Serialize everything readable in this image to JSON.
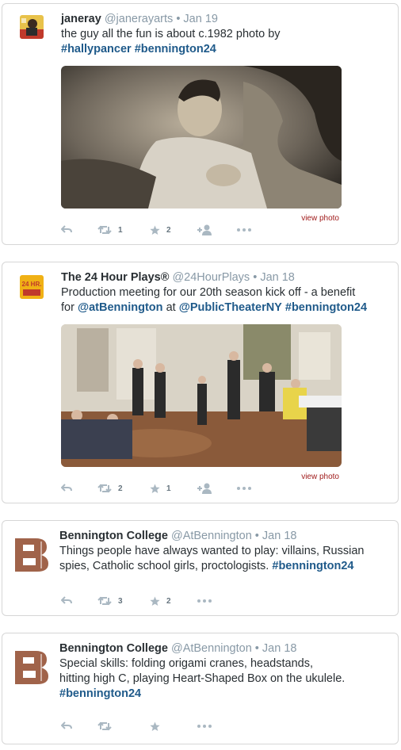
{
  "tweets": [
    {
      "name": "janeray",
      "handle": "@janerayarts",
      "dot": "•",
      "date": "Jan 19",
      "text_line1": "the guy all the fun is about c.1982 photo by",
      "hashtag1": "#hallypancer",
      "hashtag2": "#bennington24",
      "view_photo": "view photo",
      "retweets": "1",
      "favorites": "2"
    },
    {
      "name": "The 24 Hour Plays®",
      "handle": "@24HourPlays",
      "dot": "•",
      "date": "Jan 18",
      "text_line1": "Production meeting for our 20th season kick off - a benefit",
      "text_for": "for",
      "mention1": "@atBennington",
      "text_at": "at",
      "mention2": "@PublicTheaterNY",
      "hashtag1": "#bennington24",
      "view_photo": "view photo",
      "retweets": "2",
      "favorites": "1"
    },
    {
      "name": "Bennington College",
      "handle": "@AtBennington",
      "dot": "•",
      "date": "Jan 18",
      "text_line1": "Things people have always wanted to play: villains, Russian",
      "text_line2": "spies, Catholic school girls, proctologists.",
      "hashtag1": "#bennington24",
      "retweets": "3",
      "favorites": "2"
    },
    {
      "name": "Bennington College",
      "handle": "@AtBennington",
      "dot": "•",
      "date": "Jan 18",
      "text_line1": "Special skills: folding origami cranes, headstands,",
      "text_line2": "hitting high C, playing Heart-Shaped Box on the ukulele.",
      "hashtag1": "#bennington24",
      "retweets": "",
      "favorites": ""
    }
  ],
  "avatars": {
    "twentyfour_label": "24 HR."
  }
}
